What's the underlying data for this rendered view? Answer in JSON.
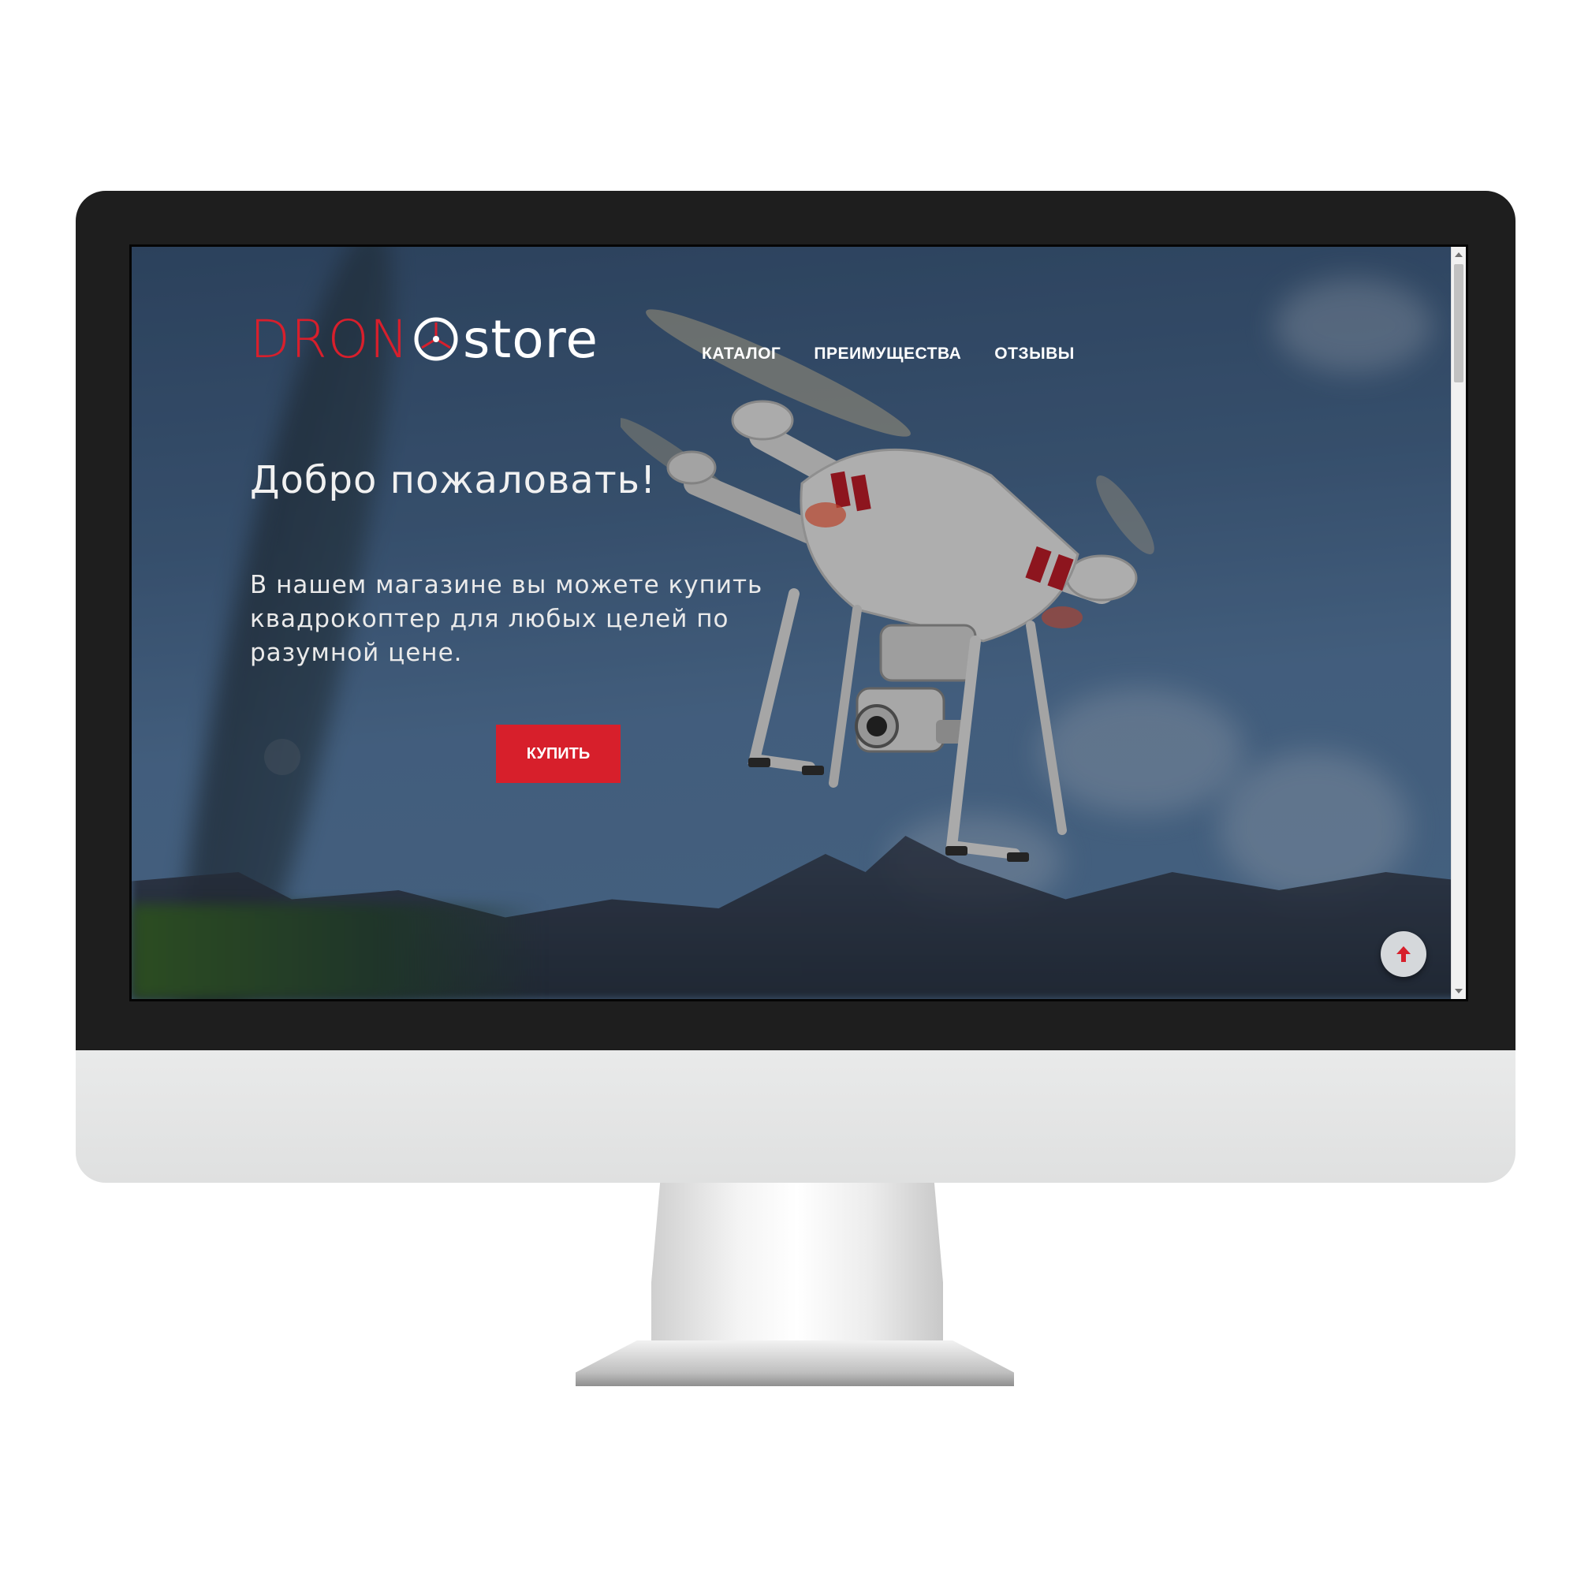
{
  "brand": {
    "logo_red": "DRON",
    "logo_white": "store",
    "accent_color": "#d71f2b"
  },
  "nav": {
    "items": [
      {
        "label": "КАТАЛОГ"
      },
      {
        "label": "ПРЕИМУЩЕСТВА"
      },
      {
        "label": "ОТЗЫВЫ"
      }
    ]
  },
  "hero": {
    "welcome": "Добро пожаловать!",
    "tagline": "В нашем магазине вы можете купить квадрокоптер для любых целей по разумной цене.",
    "buy_label": "КУПИТЬ",
    "background_image": "drone-over-city-photo"
  },
  "controls": {
    "scroll_top_icon": "arrow-up-icon"
  }
}
